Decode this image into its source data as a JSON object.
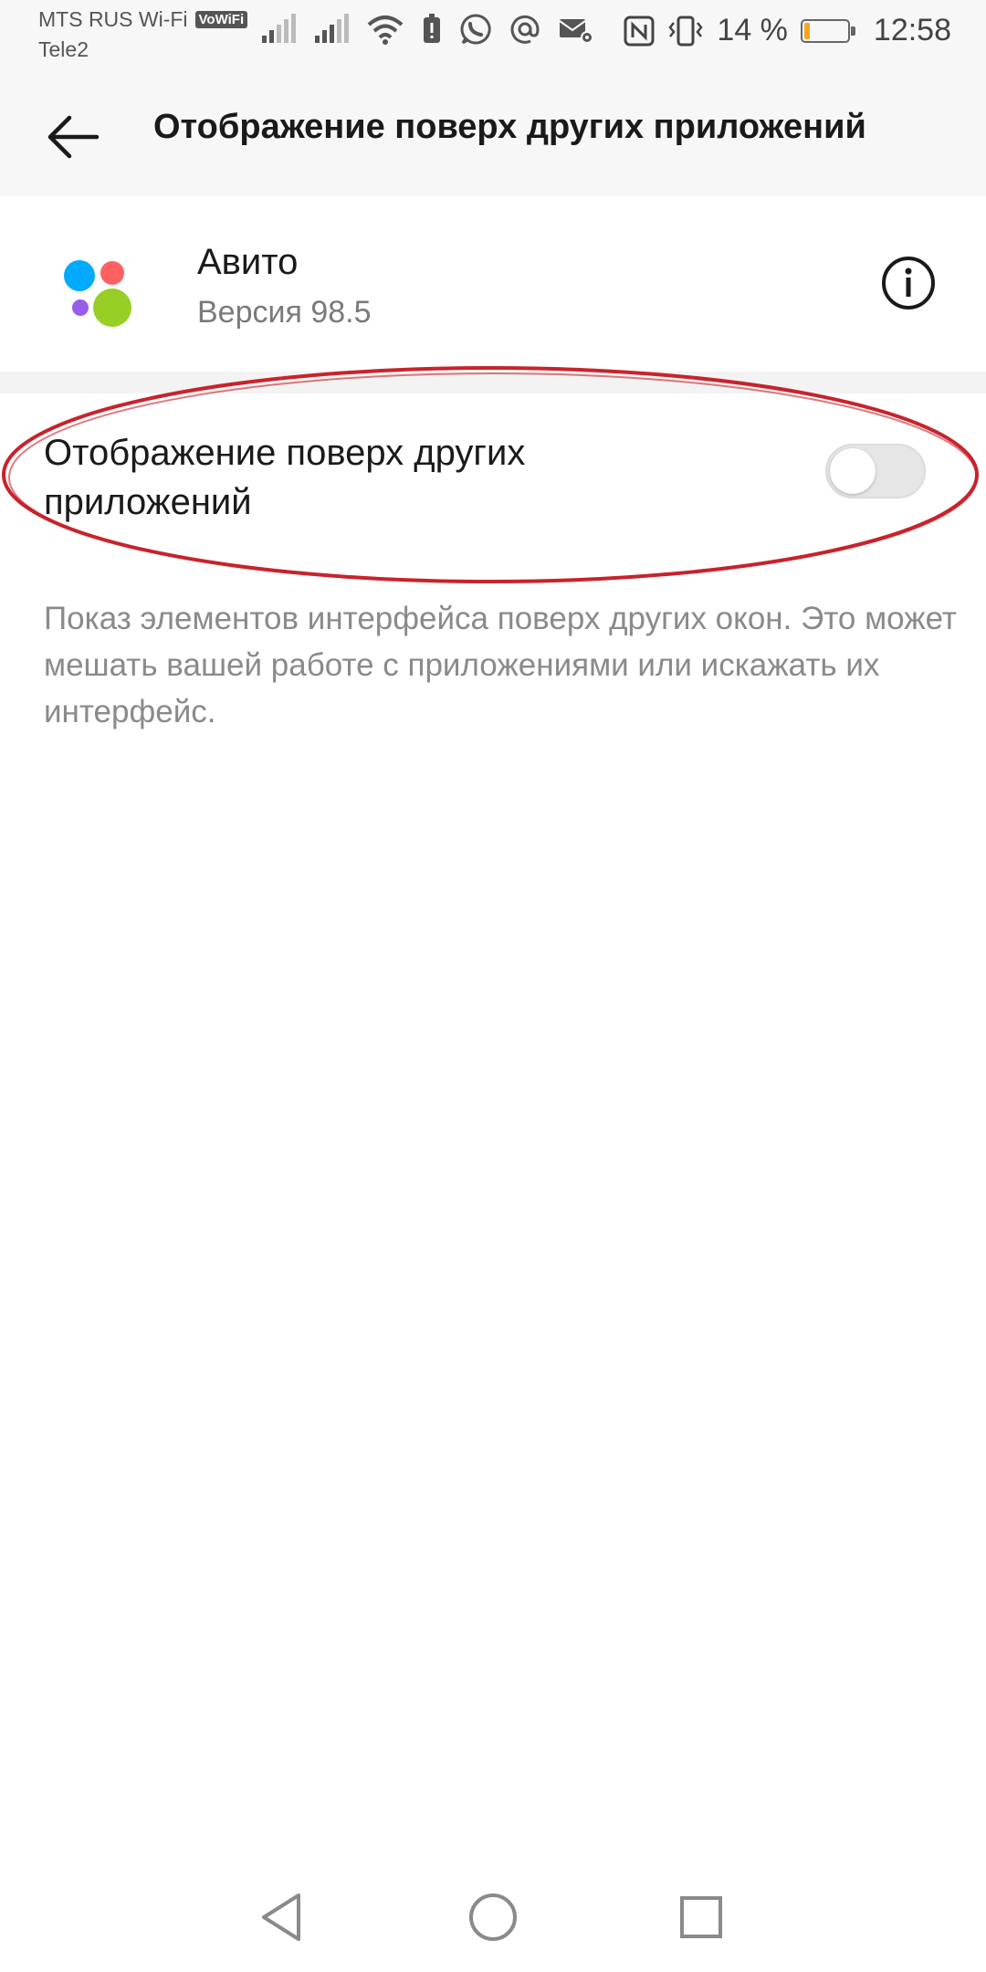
{
  "status_bar": {
    "carrier_primary": "MTS RUS Wi-Fi",
    "vowifi_badge": "VoWiFi",
    "carrier_secondary": "Tele2",
    "battery_percent": "14 %",
    "battery_level": 0.14,
    "battery_color": "#f5a623",
    "time": "12:58",
    "icons": [
      "signal-1-icon",
      "signal-2-icon",
      "wifi-icon",
      "alert-icon",
      "whatsapp-icon",
      "at-icon",
      "mail-settings-icon",
      "nfc-icon",
      "vibrate-icon",
      "battery-icon"
    ]
  },
  "app_bar": {
    "title": "Отображение поверх других приложений",
    "back_icon": "arrow-left-icon"
  },
  "app_info": {
    "name": "Авито",
    "version": "Версия 98.5",
    "info_icon": "info-icon",
    "icon_colors": {
      "blue": "#00aaff",
      "red": "#ff6163",
      "purple": "#965eeb",
      "green": "#97cf26"
    }
  },
  "setting": {
    "label": "Отображение поверх других приложений",
    "enabled": false,
    "description": "Показ элементов интерфейса поверх других окон. Это может мешать вашей работе с приложениями или искажать их интерфейс.",
    "highlight_color": "#c8232c"
  },
  "nav_bar": {
    "icons": [
      "back-triangle-icon",
      "home-circle-icon",
      "recents-square-icon"
    ]
  }
}
